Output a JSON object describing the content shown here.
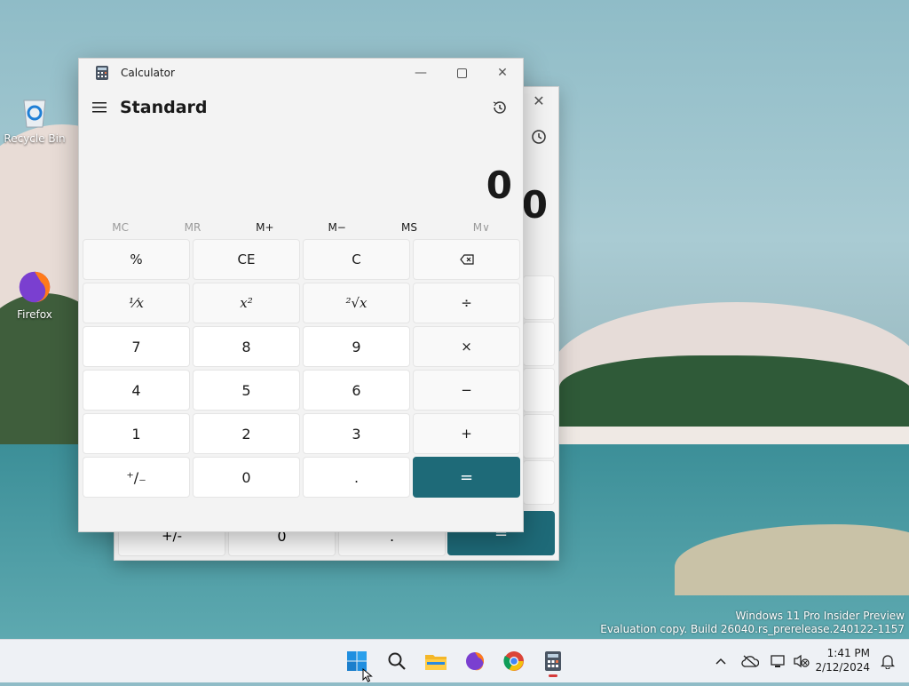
{
  "desktop": {
    "icons": [
      {
        "label": "Recycle Bin",
        "icon": "recycle-bin-icon"
      },
      {
        "label": "Firefox",
        "icon": "firefox-icon"
      }
    ],
    "watermark": {
      "line1": "Windows 11 Pro Insider Preview",
      "line2": "Evaluation copy. Build 26040.rs_prerelease.240122-1157"
    }
  },
  "back_window": {
    "display_value": "0",
    "bottom_keys": [
      "+/-",
      "0",
      ".",
      "="
    ]
  },
  "calculator": {
    "title": "Calculator",
    "mode": "Standard",
    "display_value": "0",
    "memory": [
      "MC",
      "MR",
      "M+",
      "M−",
      "MS",
      "M∨"
    ],
    "memory_disabled": [
      true,
      true,
      false,
      false,
      false,
      true
    ],
    "keys": [
      "%",
      "CE",
      "C",
      "⌫",
      "⅟x",
      "x²",
      "²√x",
      "÷",
      "7",
      "8",
      "9",
      "×",
      "4",
      "5",
      "6",
      "−",
      "1",
      "2",
      "3",
      "+",
      "⁺/₋",
      "0",
      ".",
      "="
    ],
    "accent_color": "#1e6a78"
  },
  "taskbar": {
    "apps": [
      "start-icon",
      "search-icon",
      "file-explorer-icon",
      "firefox-icon",
      "chrome-icon",
      "calculator-icon"
    ],
    "time": "1:41 PM",
    "date": "2/12/2024"
  }
}
